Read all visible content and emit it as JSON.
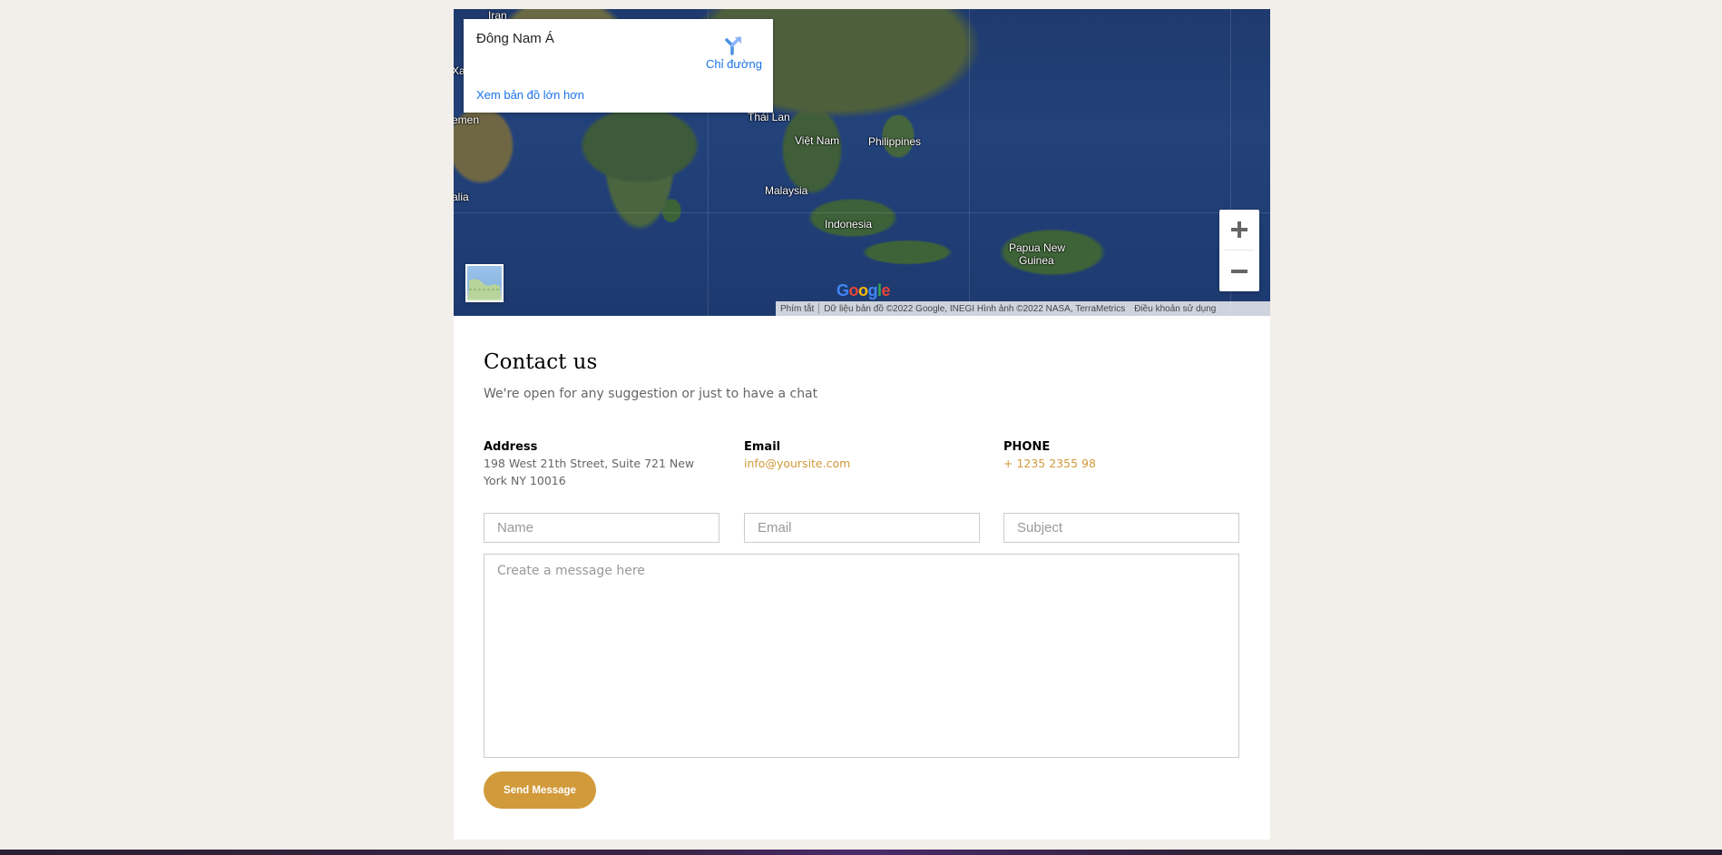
{
  "map": {
    "info_title": "Đông Nam Á",
    "directions_label": "Chỉ đường",
    "bigger_map_link": "Xem bản đồ lớn hơn",
    "labels": {
      "iran": "Iran",
      "yemen": "emen",
      "xa": "Xa",
      "somalia": "alia",
      "thailand": "Thái Lan",
      "vietnam": "Việt Nam",
      "philippines": "Philippines",
      "malaysia": "Malaysia",
      "indonesia": "Indonesia",
      "png_line1": "Papua New",
      "png_line2": "Guinea"
    },
    "google_logo": "Google",
    "attribution": {
      "shortcuts": "Phím tắt",
      "data": "Dữ liệu bản đồ ©2022 Google, INEGI Hình ảnh ©2022 NASA, TerraMetrics",
      "terms": "Điều khoản sử dụng"
    },
    "icons": {
      "directions": "directions-arrow-icon",
      "zoom_in": "plus-icon",
      "zoom_out": "minus-icon",
      "layer": "satellite-thumbnail-icon"
    }
  },
  "contact": {
    "title": "Contact us",
    "subtitle": "We're open for any suggestion or just to have a chat",
    "address": {
      "label": "Address",
      "value": "198 West 21th Street, Suite 721 New York NY 10016"
    },
    "email": {
      "label": "Email",
      "value": "info@yoursite.com"
    },
    "phone": {
      "label": "PHONE",
      "value": "+ 1235 2355 98"
    },
    "form": {
      "name_placeholder": "Name",
      "email_placeholder": "Email",
      "subject_placeholder": "Subject",
      "message_placeholder": "Create a message here",
      "send_label": "Send Message"
    }
  },
  "colors": {
    "accent": "#d19a3a",
    "page_background": "#f2efea",
    "link_blue": "#1a73e8"
  }
}
